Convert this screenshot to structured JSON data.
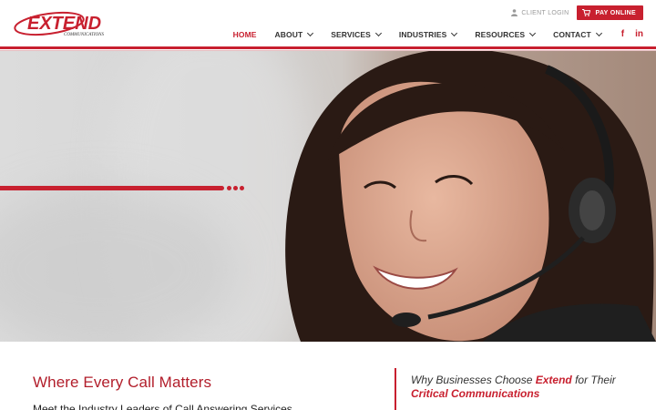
{
  "header": {
    "logo": {
      "main_text": "EXTEND",
      "sub_text": "COMMUNICATIONS"
    },
    "utility": {
      "client_login_label": "CLIENT LOGIN",
      "pay_online_label": "PAY ONLINE"
    },
    "nav": [
      {
        "label": "HOME",
        "active": true,
        "has_dropdown": false
      },
      {
        "label": "ABOUT",
        "active": false,
        "has_dropdown": true
      },
      {
        "label": "SERVICES",
        "active": false,
        "has_dropdown": true
      },
      {
        "label": "INDUSTRIES",
        "active": false,
        "has_dropdown": true
      },
      {
        "label": "RESOURCES",
        "active": false,
        "has_dropdown": true
      },
      {
        "label": "CONTACT",
        "active": false,
        "has_dropdown": true
      }
    ],
    "social": {
      "facebook_glyph": "f",
      "linkedin_glyph": "in"
    }
  },
  "hero": {
    "image_icon": "woman-with-headset-photo"
  },
  "content": {
    "headline": "Where Every Call Matters",
    "subheadline": "Meet the Industry Leaders of Call Answering Services",
    "why": {
      "prefix": "Why Businesses Choose ",
      "brand": "Extend",
      "middle": " for Their ",
      "emphasis": "Critical Communications"
    }
  },
  "colors": {
    "brand_red": "#c8202f",
    "headline_red": "#b21e2b",
    "nav_text": "#333333",
    "muted_text": "#9a9a9a"
  }
}
